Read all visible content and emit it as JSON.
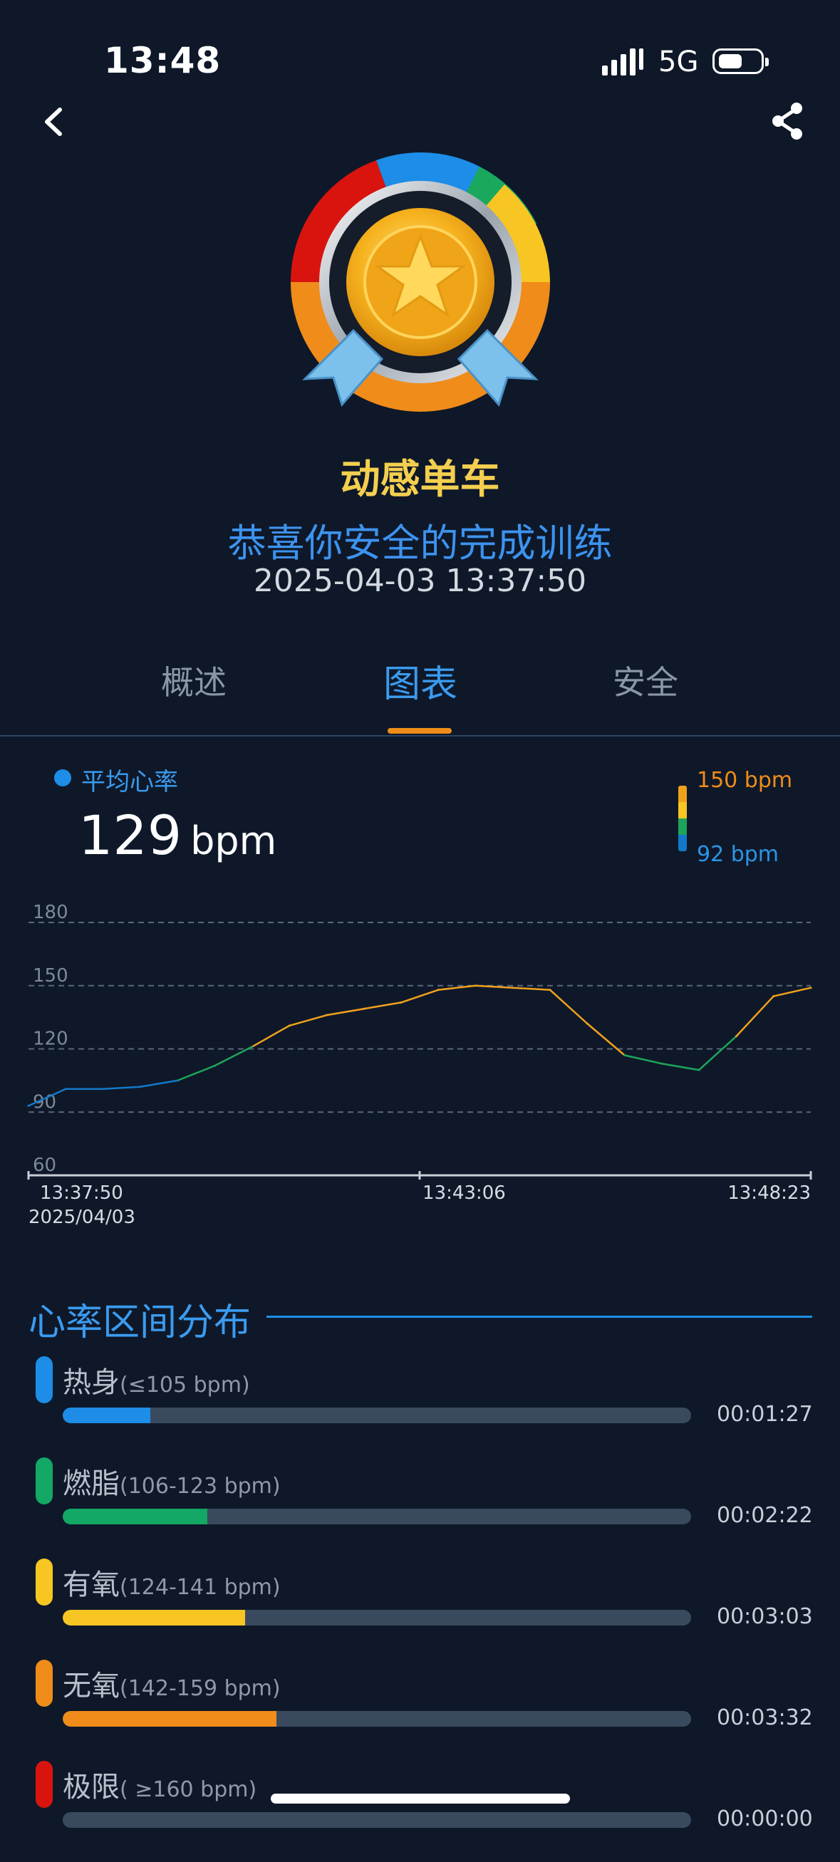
{
  "status_bar": {
    "time": "13:48",
    "network": "5G"
  },
  "header": {
    "back_icon": "chevron-left-icon",
    "share_icon": "share-icon"
  },
  "summary": {
    "sport_name": "动感单车",
    "congrats": "恭喜你安全的完成训练",
    "datetime": "2025-04-03 13:37:50"
  },
  "tabs": [
    {
      "label": "概述",
      "active": false
    },
    {
      "label": "图表",
      "active": true
    },
    {
      "label": "安全",
      "active": false
    }
  ],
  "avg_hr": {
    "label": "平均心率",
    "value": "129",
    "unit": "bpm",
    "legend_high": "150 bpm",
    "legend_low": "92 bpm"
  },
  "chart_data": {
    "type": "line",
    "title": "",
    "ylim": [
      60,
      180
    ],
    "y_ticks": [
      "180",
      "150",
      "120",
      "90",
      "60"
    ],
    "x_tick_labels": [
      "13:37:50",
      "13:43:06",
      "13:48:23"
    ],
    "x_sublabel": "2025/04/03",
    "grid": true,
    "x_minutes": [
      0,
      0.5,
      1,
      1.5,
      2,
      2.5,
      3,
      3.5,
      4,
      4.5,
      5,
      5.5,
      6,
      6.5,
      7,
      7.5,
      8,
      8.5,
      9,
      9.5,
      10,
      10.5
    ],
    "series": [
      {
        "values": [
          93,
          101,
          101,
          102,
          105,
          112,
          121,
          131,
          136,
          139,
          142,
          148,
          150,
          149,
          148,
          132,
          117,
          113,
          110,
          126,
          145,
          149
        ]
      }
    ],
    "colors": {
      "low": "#1478c8",
      "mid": "#1ea45a",
      "high": "#f0a11c"
    }
  },
  "zones_section": {
    "title": "心率区间分布",
    "zones": [
      {
        "name": "热身",
        "range": "(≤105 bpm)",
        "duration": "00:01:27",
        "fraction": 0.14,
        "color": "#1d8de8"
      },
      {
        "name": "燃脂",
        "range": "(106-123 bpm)",
        "duration": "00:02:22",
        "fraction": 0.23,
        "color": "#13a865"
      },
      {
        "name": "有氧",
        "range": "(124-141 bpm)",
        "duration": "00:03:03",
        "fraction": 0.29,
        "color": "#f7c623"
      },
      {
        "name": "无氧",
        "range": "(142-159 bpm)",
        "duration": "00:03:32",
        "fraction": 0.34,
        "color": "#ef8c1a"
      },
      {
        "name": "极限",
        "range": "( ≥160 bpm)",
        "duration": "00:00:00",
        "fraction": 0,
        "color": "#d9140f"
      }
    ]
  }
}
